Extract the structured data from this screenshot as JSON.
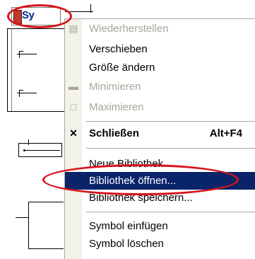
{
  "app_icon": {
    "text": "Sy",
    "icon": "application-system-menu-icon"
  },
  "menu": {
    "items": [
      {
        "label": "Wiederherstellen",
        "enabled": false,
        "icon": "restore-icon"
      },
      {
        "label": "Verschieben",
        "enabled": true
      },
      {
        "label": "Größe ändern",
        "enabled": true
      },
      {
        "label": "Minimieren",
        "enabled": false,
        "icon": "minimize-icon"
      },
      {
        "label": "Maximieren",
        "enabled": false,
        "icon": "maximize-icon"
      },
      {
        "label": "Schließen",
        "shortcut": "Alt+F4",
        "enabled": true,
        "bold": true,
        "icon": "close-icon"
      },
      {
        "label": "Neue Bibliothek...",
        "enabled": true
      },
      {
        "label": "Bibliothek öffnen...",
        "enabled": true,
        "highlighted": true
      },
      {
        "label": "Bibliothek speichern...",
        "enabled": true
      },
      {
        "label": "Symbol einfügen",
        "enabled": true
      },
      {
        "label": "Symbol löschen",
        "enabled": true
      }
    ]
  },
  "colors": {
    "highlight": "#0a246a",
    "disabled_text": "#a7a698",
    "annotation": "#d7141a"
  }
}
